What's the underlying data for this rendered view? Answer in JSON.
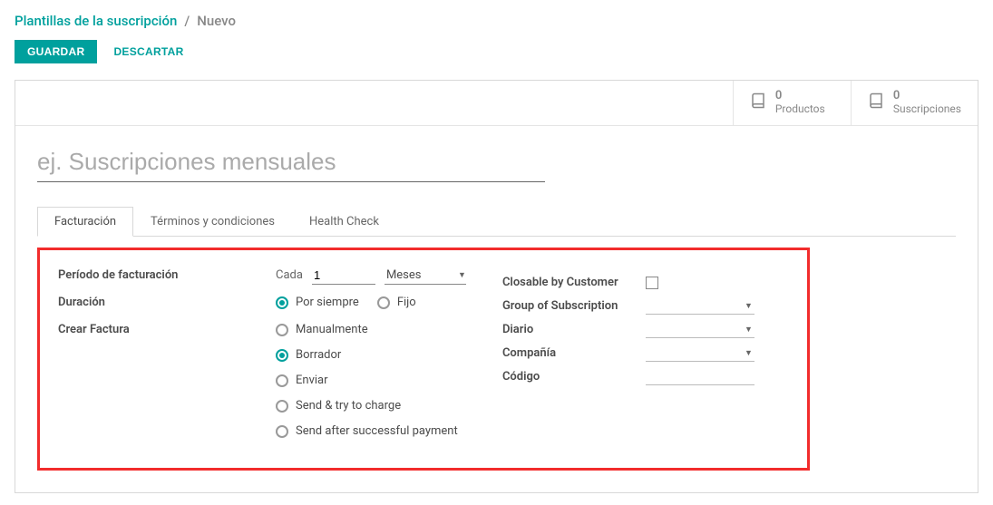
{
  "breadcrumb": {
    "root": "Plantillas de la suscripción",
    "current": "Nuevo"
  },
  "actions": {
    "save": "GUARDAR",
    "discard": "DESCARTAR"
  },
  "stats": {
    "products": {
      "value": "0",
      "label": "Productos"
    },
    "subscriptions": {
      "value": "0",
      "label": "Suscripciones"
    }
  },
  "title_placeholder": "ej. Suscripciones mensuales",
  "tabs": {
    "invoicing": "Facturación",
    "terms": "Términos y condiciones",
    "health": "Health Check"
  },
  "form": {
    "period_label": "Período de facturación",
    "duration_label": "Duración",
    "create_invoice_label": "Crear Factura",
    "cada": "Cada",
    "period_value": "1",
    "period_unit": "Meses",
    "duration_options": {
      "forever": "Por siempre",
      "fixed": "Fijo"
    },
    "invoice_options": {
      "manual": "Manualmente",
      "draft": "Borrador",
      "send": "Enviar",
      "send_try": "Send & try to charge",
      "send_after": "Send after successful payment"
    },
    "right": {
      "closable": "Closable by Customer",
      "group": "Group of Subscription",
      "journal": "Diario",
      "company": "Compañía",
      "code": "Código"
    }
  }
}
